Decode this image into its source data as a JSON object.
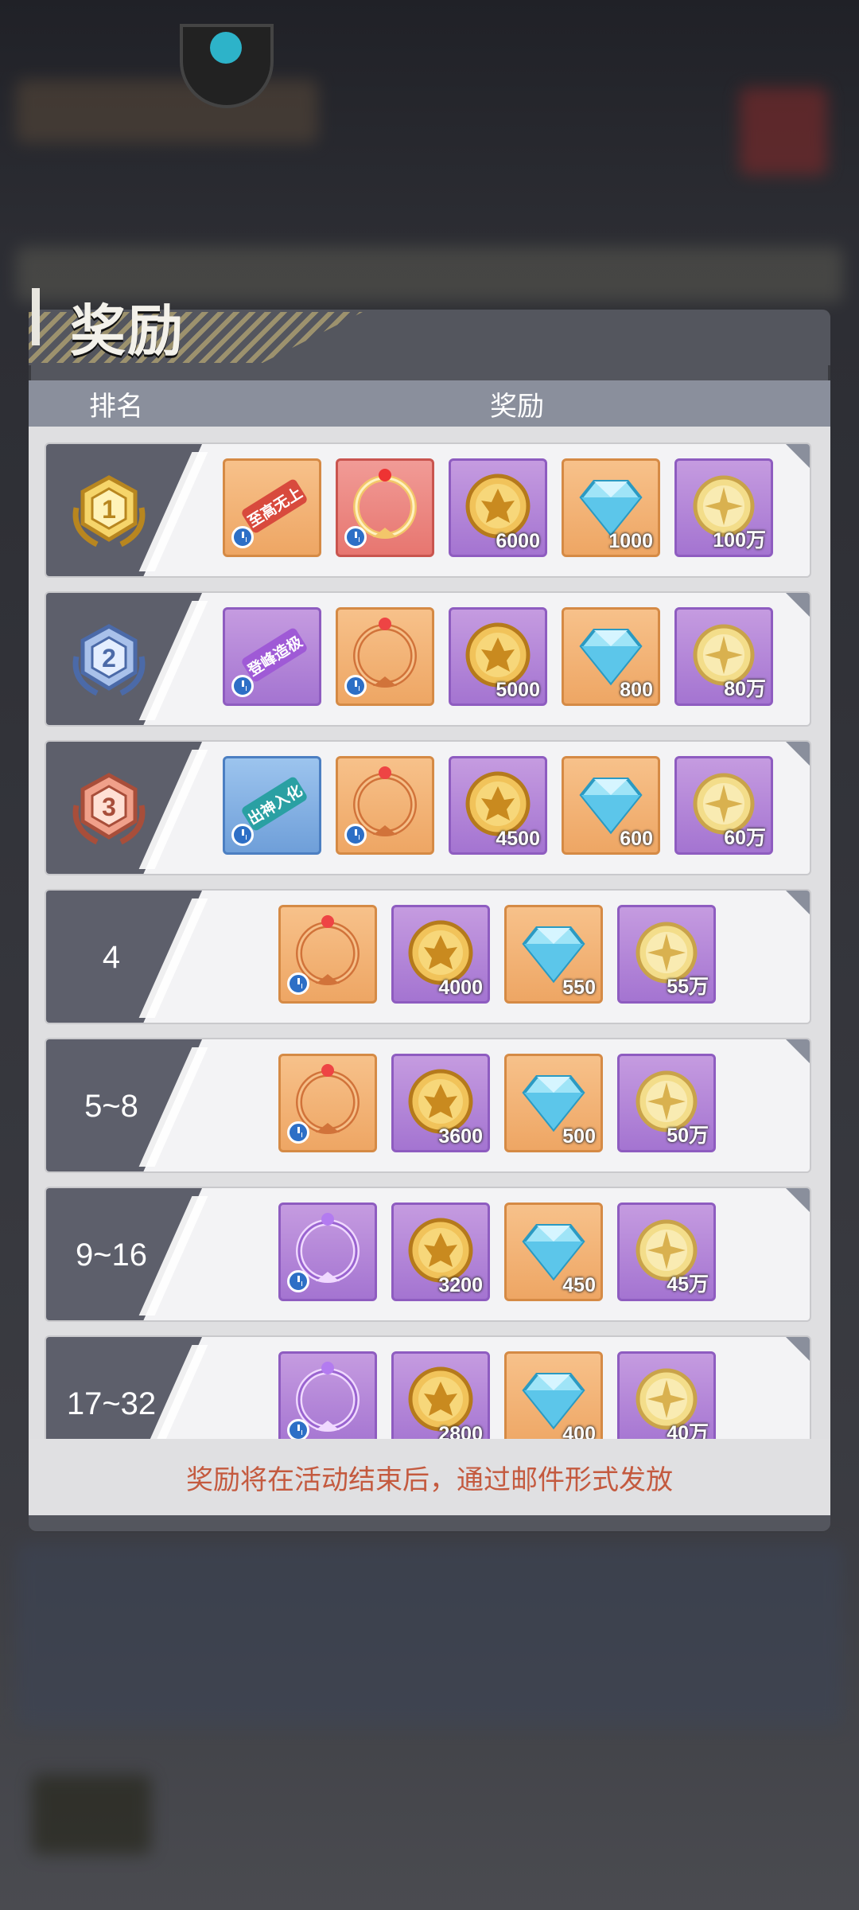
{
  "modal": {
    "title": "奖励",
    "header_rank": "排名",
    "header_reward": "奖励",
    "footer_note": "奖励将在活动结束后，通过邮件形式发放"
  },
  "rows": [
    {
      "rank": "1",
      "medal": "gold",
      "items": [
        {
          "type": "title-scroll",
          "color": "orange",
          "label": "至高无上",
          "timed": true
        },
        {
          "type": "avatar-frame",
          "color": "red",
          "timed": true
        },
        {
          "type": "gold-emblem",
          "color": "purple",
          "qty": "6000"
        },
        {
          "type": "diamond",
          "color": "orange",
          "qty": "1000"
        },
        {
          "type": "gold-coin",
          "color": "purple",
          "qty": "100万"
        }
      ]
    },
    {
      "rank": "2",
      "medal": "silver",
      "items": [
        {
          "type": "title-scroll",
          "color": "purple",
          "label": "登峰造极",
          "timed": true
        },
        {
          "type": "avatar-frame",
          "color": "orange",
          "timed": true
        },
        {
          "type": "gold-emblem",
          "color": "purple",
          "qty": "5000"
        },
        {
          "type": "diamond",
          "color": "orange",
          "qty": "800"
        },
        {
          "type": "gold-coin",
          "color": "purple",
          "qty": "80万"
        }
      ]
    },
    {
      "rank": "3",
      "medal": "bronze",
      "items": [
        {
          "type": "title-scroll",
          "color": "blue",
          "label": "出神入化",
          "timed": true
        },
        {
          "type": "avatar-frame",
          "color": "orange",
          "timed": true
        },
        {
          "type": "gold-emblem",
          "color": "purple",
          "qty": "4500"
        },
        {
          "type": "diamond",
          "color": "orange",
          "qty": "600"
        },
        {
          "type": "gold-coin",
          "color": "purple",
          "qty": "60万"
        }
      ]
    },
    {
      "rank": "4",
      "items": [
        {
          "type": "avatar-frame",
          "color": "orange",
          "timed": true
        },
        {
          "type": "gold-emblem",
          "color": "purple",
          "qty": "4000"
        },
        {
          "type": "diamond",
          "color": "orange",
          "qty": "550"
        },
        {
          "type": "gold-coin",
          "color": "purple",
          "qty": "55万"
        }
      ]
    },
    {
      "rank": "5~8",
      "items": [
        {
          "type": "avatar-frame",
          "color": "orange",
          "timed": true
        },
        {
          "type": "gold-emblem",
          "color": "purple",
          "qty": "3600"
        },
        {
          "type": "diamond",
          "color": "orange",
          "qty": "500"
        },
        {
          "type": "gold-coin",
          "color": "purple",
          "qty": "50万"
        }
      ]
    },
    {
      "rank": "9~16",
      "items": [
        {
          "type": "avatar-frame",
          "color": "purple",
          "timed": true
        },
        {
          "type": "gold-emblem",
          "color": "purple",
          "qty": "3200"
        },
        {
          "type": "diamond",
          "color": "orange",
          "qty": "450"
        },
        {
          "type": "gold-coin",
          "color": "purple",
          "qty": "45万"
        }
      ]
    },
    {
      "rank": "17~32",
      "items": [
        {
          "type": "avatar-frame",
          "color": "purple",
          "timed": true
        },
        {
          "type": "gold-emblem",
          "color": "purple",
          "qty": "2800"
        },
        {
          "type": "diamond",
          "color": "orange",
          "qty": "400"
        },
        {
          "type": "gold-coin",
          "color": "purple",
          "qty": "40万"
        }
      ]
    }
  ]
}
